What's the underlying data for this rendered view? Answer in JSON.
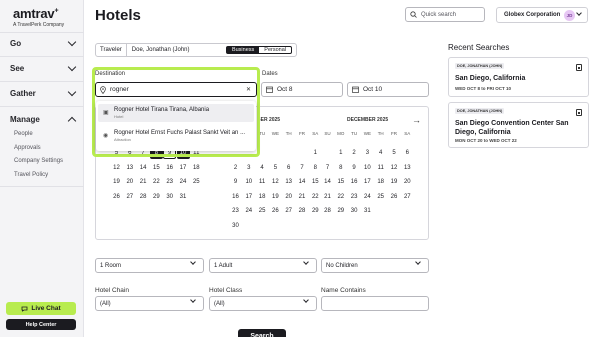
{
  "brand": {
    "name": "amtrav",
    "sup": "+",
    "sub": "A TravelPerk Company"
  },
  "nav": {
    "go": "Go",
    "see": "See",
    "gather": "Gather",
    "manage": "Manage",
    "manage_items": [
      "People",
      "Approvals",
      "Company Settings",
      "Travel Policy"
    ]
  },
  "live_chat": "Live Chat",
  "help_center": "Help Center",
  "header": {
    "title": "Hotels",
    "quick_search": "Quick search",
    "company": "Globex Corporation",
    "avatar": "JD"
  },
  "traveler": {
    "label": "Traveler",
    "name": "Doe, Jonathan (John)",
    "business": "Business",
    "personal": "Personal"
  },
  "destination": {
    "label": "Destination",
    "value": "rogner",
    "suggestions": [
      {
        "title": "Rogner Hotel Tirana Tirana, Albania",
        "type": "Hotel"
      },
      {
        "title": "Rogner Hotel Ernst Fuchs Palast Sankt Veit an ...",
        "type": "Attraction"
      }
    ]
  },
  "dates": {
    "label": "Dates",
    "checkin": "Oct 8",
    "checkout": "Oct 10"
  },
  "calendar": {
    "dow": [
      "SU",
      "MO",
      "TU",
      "WE",
      "TH",
      "FR",
      "SA"
    ],
    "months": [
      {
        "name": "",
        "rows": [
          [
            "",
            "",
            "",
            "",
            "",
            "",
            ""
          ],
          [
            "5",
            "6",
            "7",
            "8",
            "9",
            "10",
            "11"
          ],
          [
            "12",
            "13",
            "14",
            "15",
            "16",
            "17",
            "18"
          ],
          [
            "19",
            "20",
            "21",
            "22",
            "23",
            "24",
            "25"
          ],
          [
            "26",
            "27",
            "28",
            "29",
            "30",
            "31",
            ""
          ]
        ]
      },
      {
        "name": "BER 2025",
        "rows": [
          [
            "",
            "",
            "",
            "",
            "",
            "",
            "1"
          ],
          [
            "2",
            "3",
            "4",
            "5",
            "6",
            "7",
            "8"
          ],
          [
            "9",
            "10",
            "11",
            "12",
            "13",
            "14",
            "15"
          ],
          [
            "16",
            "17",
            "18",
            "19",
            "20",
            "21",
            "22"
          ],
          [
            "23",
            "24",
            "25",
            "26",
            "27",
            "28",
            "29"
          ],
          [
            "30",
            "",
            "",
            "",
            "",
            "",
            ""
          ]
        ]
      },
      {
        "name": "DECEMBER 2025",
        "rows": [
          [
            "",
            "1",
            "2",
            "3",
            "4",
            "5",
            "6"
          ],
          [
            "7",
            "8",
            "9",
            "10",
            "11",
            "12",
            "13"
          ],
          [
            "14",
            "15",
            "16",
            "17",
            "18",
            "19",
            "20"
          ],
          [
            "21",
            "22",
            "23",
            "24",
            "25",
            "26",
            "27"
          ],
          [
            "28",
            "29",
            "30",
            "31",
            "",
            "",
            ""
          ]
        ]
      }
    ]
  },
  "options": {
    "rooms": "1 Room",
    "adults": "1 Adult",
    "children": "No Children",
    "hotel_chain_label": "Hotel Chain",
    "hotel_chain": "(All)",
    "hotel_class_label": "Hotel Class",
    "hotel_class": "(All)",
    "name_contains_label": "Name Contains",
    "search": "Search"
  },
  "recent": {
    "title": "Recent Searches",
    "items": [
      {
        "tag": "DOE, JONATHAN (JOHN)",
        "city": "San Diego, California",
        "dates": "WED OCT 8  to  FRI OCT 10"
      },
      {
        "tag": "DOE, JONATHAN (JOHN)",
        "city": "San Diego Convention Center San Diego, California",
        "dates": "MON OCT 20  to  WED OCT 22"
      }
    ]
  }
}
